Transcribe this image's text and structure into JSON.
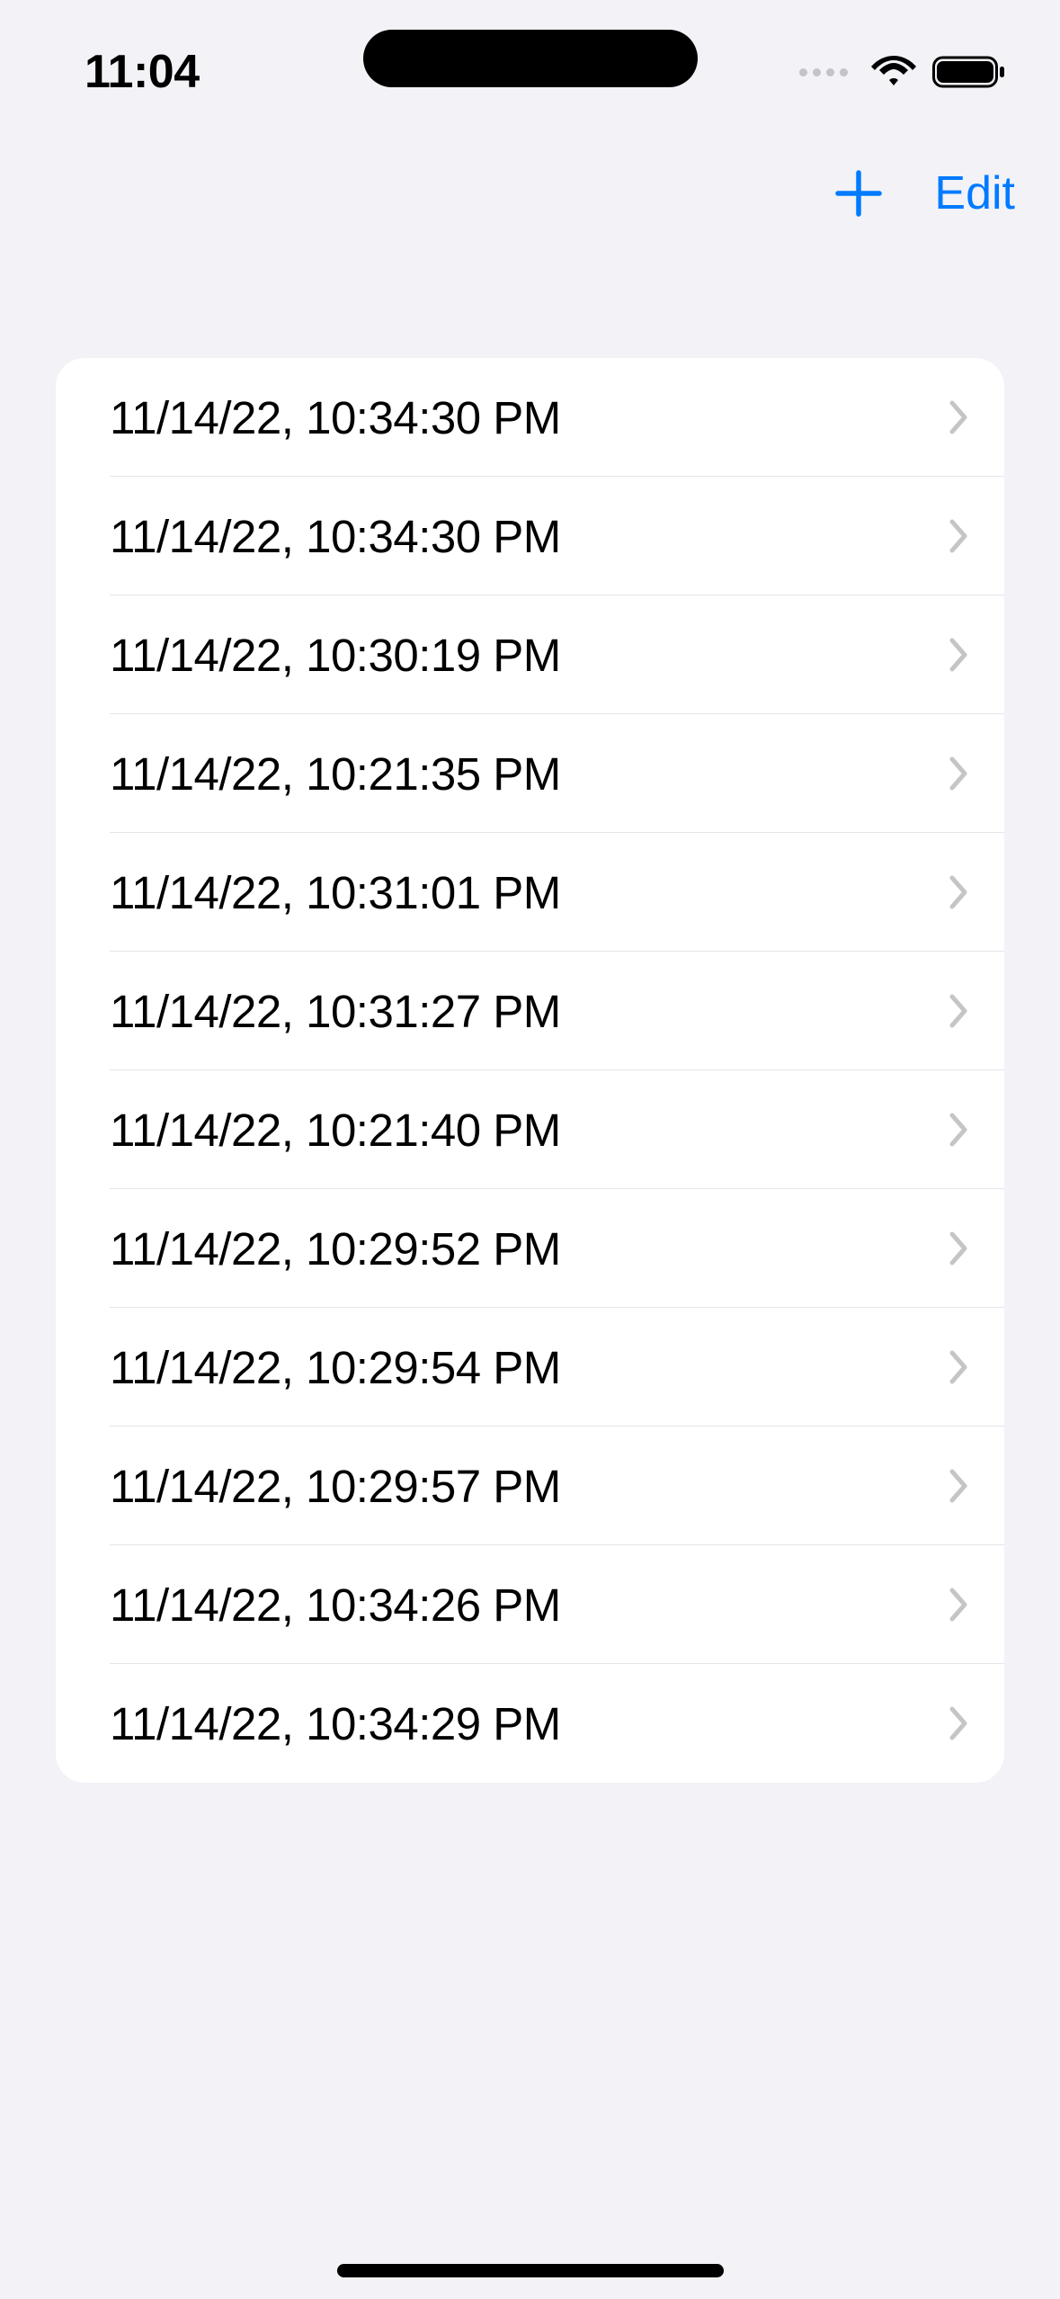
{
  "status": {
    "time": "11:04"
  },
  "nav": {
    "edit_label": "Edit"
  },
  "list": {
    "items": [
      {
        "label": "11/14/22, 10:34:30 PM"
      },
      {
        "label": "11/14/22, 10:34:30 PM"
      },
      {
        "label": "11/14/22, 10:30:19 PM"
      },
      {
        "label": "11/14/22, 10:21:35 PM"
      },
      {
        "label": "11/14/22, 10:31:01 PM"
      },
      {
        "label": "11/14/22, 10:31:27 PM"
      },
      {
        "label": "11/14/22, 10:21:40 PM"
      },
      {
        "label": "11/14/22, 10:29:52 PM"
      },
      {
        "label": "11/14/22, 10:29:54 PM"
      },
      {
        "label": "11/14/22, 10:29:57 PM"
      },
      {
        "label": "11/14/22, 10:34:26 PM"
      },
      {
        "label": "11/14/22, 10:34:29 PM"
      }
    ]
  }
}
